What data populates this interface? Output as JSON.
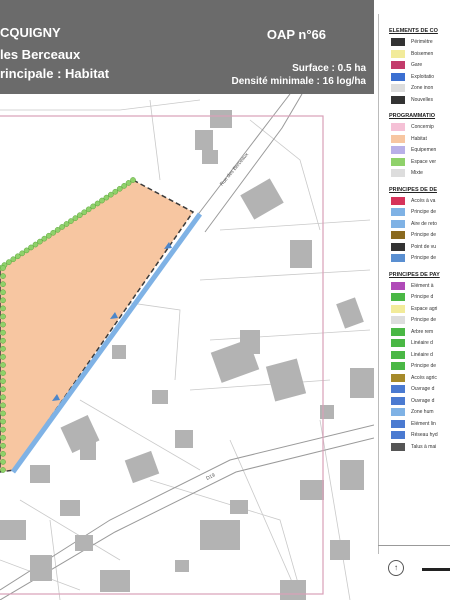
{
  "header": {
    "commune": "CQUIGNY",
    "site": "les Berceaux",
    "vocation": "rincipale : Habitat",
    "oap": "OAP n°66",
    "surface": "Surface : 0.5 ha",
    "density": "Densité minimale : 16 log/ha"
  },
  "map": {
    "street_label_1": "Rue des Berceaux",
    "street_label_2": "D19"
  },
  "legend": {
    "sections": [
      {
        "title": "ELEMENTS DE CO",
        "items": [
          "Périmètre",
          "Boisemen",
          "Gare",
          "Exploitatio",
          "Zone inon",
          "Nouvelles"
        ]
      },
      {
        "title": "PROGRAMMATIO",
        "items": [
          "Concernip",
          "Habitat",
          "Equipemen",
          "Espace ver",
          "Mixte"
        ]
      },
      {
        "title": "PRINCIPES DE DE",
        "items": [
          "Accès à va",
          "Principe de",
          "Aire de reto",
          "Principe de",
          "Point de vu",
          "Principe de"
        ]
      },
      {
        "title": "PRINCIPES DE PAY",
        "items": [
          "Elément à",
          "Principe d",
          "Espace agri",
          "Principe de",
          "Arbre rem",
          "Linéaire d",
          "Linéaire d",
          "Principe de",
          "Accès agric",
          "Ouvrage d",
          "Ouvrage d",
          "Zone hum",
          "Elément lin",
          "Réseau hyd",
          "Talus à mai"
        ]
      }
    ]
  },
  "colors": {
    "header_bg": "#6b6b6b",
    "habitat": "#f7c6a1",
    "espace_vert": "#8fd16a",
    "principe_bleu": "#7fb2e5",
    "perimetre": "#d9a0b8",
    "bati": "#b3b3b3"
  }
}
